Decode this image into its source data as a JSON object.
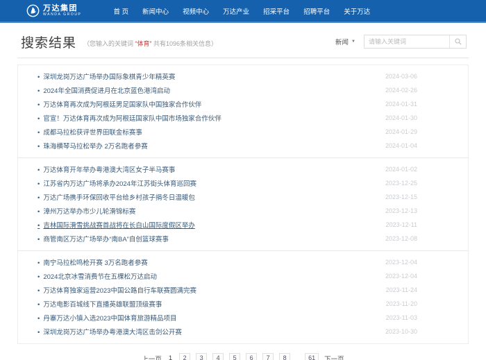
{
  "colors": {
    "topbar_blue": "#1561ae",
    "link_blue": "#3a5a78",
    "keyword_red": "#c34040",
    "date_gray": "#c9cdd2"
  },
  "topbar": {
    "logo": {
      "name_cn": "万达集团",
      "name_en": "WANDA GROUP"
    },
    "nav_items": [
      "首 页",
      "新闻中心",
      "视频中心",
      "万达产业",
      "招采平台",
      "招聘平台",
      "关于万达"
    ]
  },
  "search": {
    "page_title": "搜索结果",
    "summary_prefix": "（您输入的关键词 ",
    "keyword": "“体育”",
    "summary_suffix": " 共有1096条相关信息）",
    "category_selected": "新闻",
    "input_placeholder": "请输入关键词",
    "input_value": ""
  },
  "icons": {
    "caret_down": "▼",
    "search_icon": "magnifier",
    "logo_icon": "wanda-circle-sail"
  },
  "results": {
    "groups": [
      {
        "items": [
          {
            "title": "深圳龙岗万达广场举办国际象棋青少年精英赛",
            "date": "2024-03-06"
          },
          {
            "title": "2024年全国消费促进月在北京蓝色港湾启动",
            "date": "2024-02-26"
          },
          {
            "title": "万达体育再次成为阿根廷男足国家队中国独家合作伙伴",
            "date": "2024-01-31"
          },
          {
            "title": "官宣！万达体育再次成为阿根廷国家队中国市场独家合作伙伴",
            "date": "2024-01-30"
          },
          {
            "title": "成都马拉松获评世界田联金标赛事",
            "date": "2024-01-29"
          },
          {
            "title": "珠海横琴马拉松举办 2万名跑者参赛",
            "date": "2024-01-04"
          }
        ]
      },
      {
        "items": [
          {
            "title": "万达体育开年举办粤港澳大湾区女子半马赛事",
            "date": "2024-01-02"
          },
          {
            "title": "江苏省内万达广场将承办2024年江苏街头体育巡回赛",
            "date": "2023-12-25"
          },
          {
            "title": "万达广场携手环保回收平台给乡村孩子捐冬日温暖包",
            "date": "2023-12-15"
          },
          {
            "title": "漳州万达举办市少儿轮滑锦标赛",
            "date": "2023-12-13"
          },
          {
            "title": "吉林国际滑雪挑战赛首战将在长白山国际度假区举办",
            "date": "2023-12-11"
          },
          {
            "title": "商管南区万达广场举办“南BA”自创篮球赛事",
            "date": "2023-12-08"
          }
        ]
      },
      {
        "items": [
          {
            "title": "南宁马拉松鸣枪开赛 3万名跑者参赛",
            "date": "2023-12-04"
          },
          {
            "title": "2024北京冰雪消费节在五棵松万达启动",
            "date": "2023-12-04"
          },
          {
            "title": "万达体育独家运营2023中国公路自行车联赛圆满完赛",
            "date": "2023-11-24"
          },
          {
            "title": "万达电影百城线下直播英雄联盟顶级赛事",
            "date": "2023-11-20"
          },
          {
            "title": "丹寨万达小镇入选2023中国体育旅游精品项目",
            "date": "2023-11-03"
          },
          {
            "title": "深圳龙岗万达广场举办粤港澳大湾区击剑公开赛",
            "date": "2023-10-30"
          }
        ]
      }
    ]
  },
  "pagination": {
    "prev_label": "上一页",
    "current_page": "1",
    "pages": [
      "2",
      "3",
      "4",
      "5",
      "6",
      "7",
      "8"
    ],
    "ellipsis": "..",
    "last_page": "61",
    "next_label": "下一页"
  }
}
